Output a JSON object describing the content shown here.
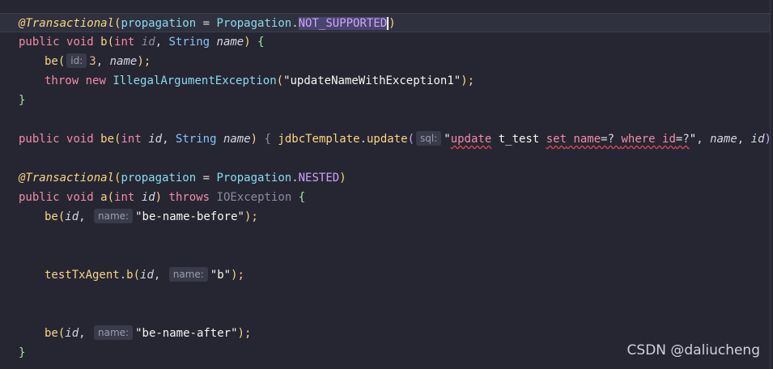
{
  "code": {
    "line1": {
      "annotation": "@Transactional",
      "open": "(",
      "param": "propagation",
      "eq": " = ",
      "enum_class": "Propagation",
      "dot": ".",
      "enum_value": "NOT_SUPPORTED",
      "close": ")"
    },
    "line2": {
      "kw1": "public",
      "kw2": "void",
      "fn": "b",
      "open": "(",
      "type1": "int",
      "p1": "id",
      "comma": ", ",
      "type2": "String",
      "p2": "name",
      "close": ")",
      "brace": "{"
    },
    "line3": {
      "fn": "be",
      "open": "(",
      "hint": "id:",
      "num": "3",
      "comma": ", ",
      "p": "name",
      "close": ");"
    },
    "line4": {
      "kw1": "throw",
      "kw2": "new",
      "cls": "IllegalArgumentException",
      "open": "(",
      "str": "\"updateNameWithException1\"",
      "close": ");"
    },
    "line5": {
      "brace": "}"
    },
    "line7": {
      "kw1": "public",
      "kw2": "void",
      "fn": "be",
      "open": "(",
      "type1": "int",
      "p1": "id",
      "comma": ", ",
      "type2": "String",
      "p2": "name",
      "close": ")",
      "brace_open": "{",
      "obj": "jdbcTemplate",
      "dot": ".",
      "method": "update",
      "call_open": "(",
      "hint": "sql:",
      "q1": "\"",
      "sql_update": "update",
      "sql_table": " t_test ",
      "sql_set": "set",
      "sql_name": " name",
      "sql_eq1": "=? ",
      "sql_where": "where",
      "sql_id": " id",
      "sql_eq2": "=?",
      "q2": "\"",
      "comma2": ", ",
      "arg1": "name",
      "comma3": ", ",
      "arg2": "id",
      "call_close": ");",
      "brace_close": "}"
    },
    "line9": {
      "annotation": "@Transactional",
      "open": "(",
      "param": "propagation",
      "eq": " = ",
      "enum_class": "Propagation",
      "dot": ".",
      "enum_value": "NESTED",
      "close": ")"
    },
    "line10": {
      "kw1": "public",
      "kw2": "void",
      "fn": "a",
      "open": "(",
      "type1": "int",
      "p1": "id",
      "close": ")",
      "kw3": "throws",
      "exc": "IOException",
      "brace": "{"
    },
    "line11": {
      "fn": "be",
      "open": "(",
      "p": "id",
      "comma": ", ",
      "hint": "name:",
      "str": "\"be-name-before\"",
      "close": ");"
    },
    "line14": {
      "obj": "testTxAgent",
      "dot": ".",
      "fn": "b",
      "open": "(",
      "p": "id",
      "comma": ", ",
      "hint": "name:",
      "str": "\"b\"",
      "close": ");"
    },
    "line17": {
      "fn": "be",
      "open": "(",
      "p": "id",
      "comma": ", ",
      "hint": "name:",
      "str": "\"be-name-after\"",
      "close": ");"
    },
    "line18": {
      "brace": "}"
    }
  },
  "watermark": "CSDN @daliucheng"
}
